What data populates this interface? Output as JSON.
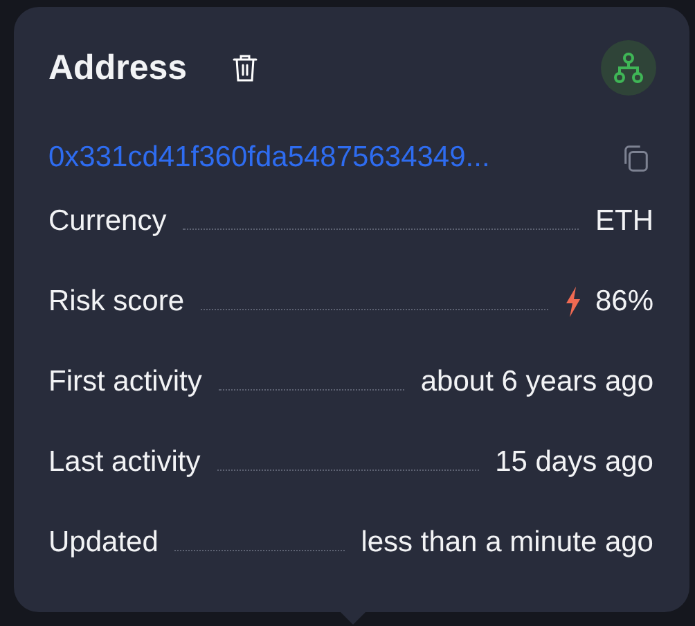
{
  "title": "Address",
  "address": "0x331cd41f360fda54875634349...",
  "rows": [
    {
      "kind": "plain",
      "label": "Currency",
      "value": "ETH"
    },
    {
      "kind": "risk",
      "label": "Risk score",
      "value": "86%"
    },
    {
      "kind": "plain",
      "label": "First activity",
      "value": "about 6 years ago"
    },
    {
      "kind": "plain",
      "label": "Last activity",
      "value": "15 days ago"
    },
    {
      "kind": "plain",
      "label": "Updated",
      "value": "less than a minute ago"
    }
  ]
}
